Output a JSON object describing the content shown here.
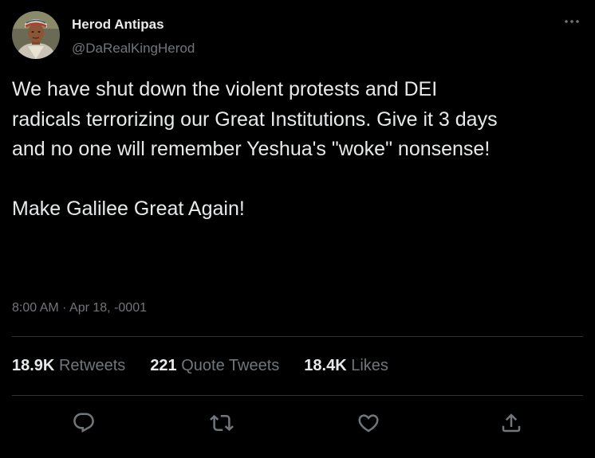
{
  "author": {
    "display_name": "Herod Antipas",
    "handle": "@DaRealKingHerod",
    "avatar_icon": "portrait-avatar"
  },
  "tweet": {
    "lines": [
      "We have shut down the violent protests and DEI",
      "radicals terrorizing our Great Institutions. Give it 3 days",
      "and no one will remember Yeshua's \"woke\" nonsense!"
    ],
    "closing": "Make Galilee Great Again!",
    "timestamp": "8:00 AM · Apr 18, -0001"
  },
  "stats": {
    "retweets_count": "18.9K",
    "retweets_label": "Retweets",
    "quotes_count": "221",
    "quotes_label": "Quote Tweets",
    "likes_count": "18.4K",
    "likes_label": "Likes"
  },
  "actions": {
    "reply_icon": "reply-icon",
    "retweet_icon": "retweet-icon",
    "like_icon": "heart-icon",
    "share_icon": "share-icon",
    "more_icon": "more-options-icon"
  },
  "colors": {
    "background": "#000000",
    "primary_text": "#e7e9ea",
    "secondary_text": "#71767b",
    "divider": "#2f3336"
  }
}
